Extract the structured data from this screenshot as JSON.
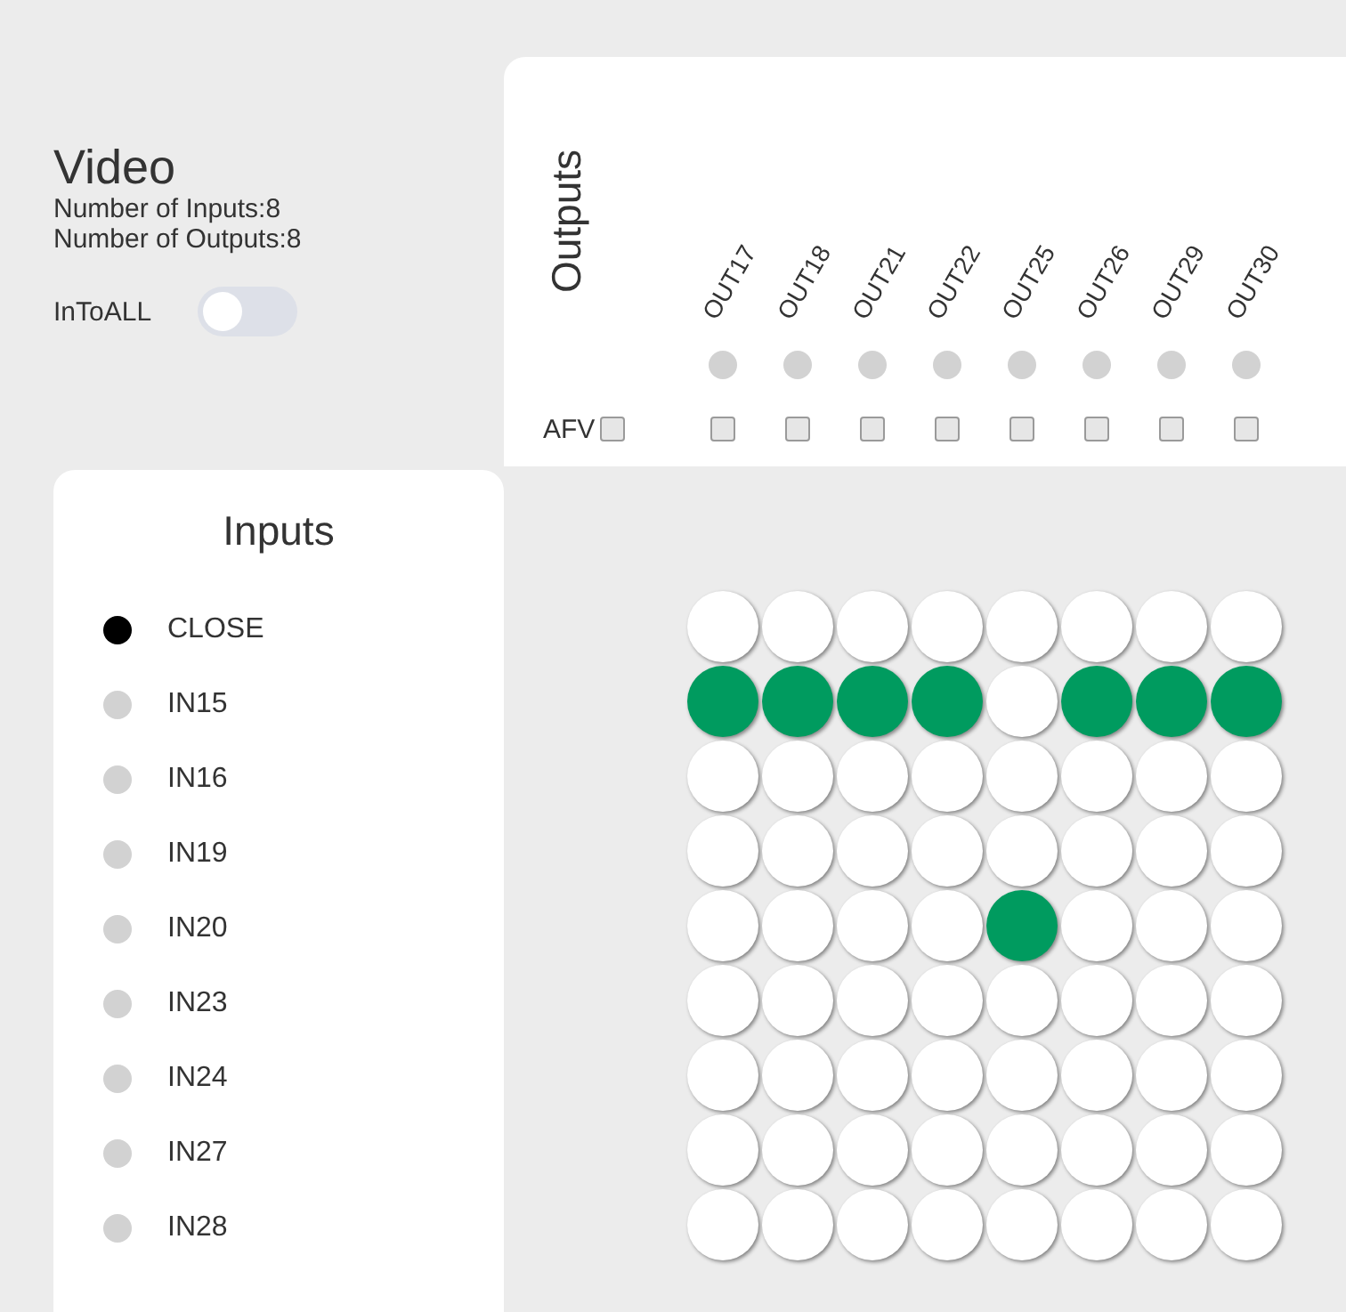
{
  "video": {
    "title": "Video",
    "inputs_count": "Number of Inputs:8",
    "outputs_count": "Number of Outputs:8",
    "intoall": {
      "label": "InToALL",
      "on": false
    }
  },
  "outputs": {
    "title": "Outputs",
    "afv": {
      "label": "AFV",
      "checked": false
    },
    "columns": [
      {
        "label": "OUT17",
        "checked": false
      },
      {
        "label": "OUT18",
        "checked": false
      },
      {
        "label": "OUT21",
        "checked": false
      },
      {
        "label": "OUT22",
        "checked": false
      },
      {
        "label": "OUT25",
        "checked": false
      },
      {
        "label": "OUT26",
        "checked": false
      },
      {
        "label": "OUT29",
        "checked": false
      },
      {
        "label": "OUT30",
        "checked": false
      }
    ]
  },
  "inputs": {
    "title": "Inputs",
    "items": [
      {
        "label": "CLOSE",
        "selected": true
      },
      {
        "label": "IN15",
        "selected": false
      },
      {
        "label": "IN16",
        "selected": false
      },
      {
        "label": "IN19",
        "selected": false
      },
      {
        "label": "IN20",
        "selected": false
      },
      {
        "label": "IN23",
        "selected": false
      },
      {
        "label": "IN24",
        "selected": false
      },
      {
        "label": "IN27",
        "selected": false
      },
      {
        "label": "IN28",
        "selected": false
      }
    ]
  },
  "matrix": [
    [
      false,
      false,
      false,
      false,
      false,
      false,
      false,
      false
    ],
    [
      true,
      true,
      true,
      true,
      false,
      true,
      true,
      true
    ],
    [
      false,
      false,
      false,
      false,
      false,
      false,
      false,
      false
    ],
    [
      false,
      false,
      false,
      false,
      false,
      false,
      false,
      false
    ],
    [
      false,
      false,
      false,
      false,
      true,
      false,
      false,
      false
    ],
    [
      false,
      false,
      false,
      false,
      false,
      false,
      false,
      false
    ],
    [
      false,
      false,
      false,
      false,
      false,
      false,
      false,
      false
    ],
    [
      false,
      false,
      false,
      false,
      false,
      false,
      false,
      false
    ],
    [
      false,
      false,
      false,
      false,
      false,
      false,
      false,
      false
    ]
  ]
}
